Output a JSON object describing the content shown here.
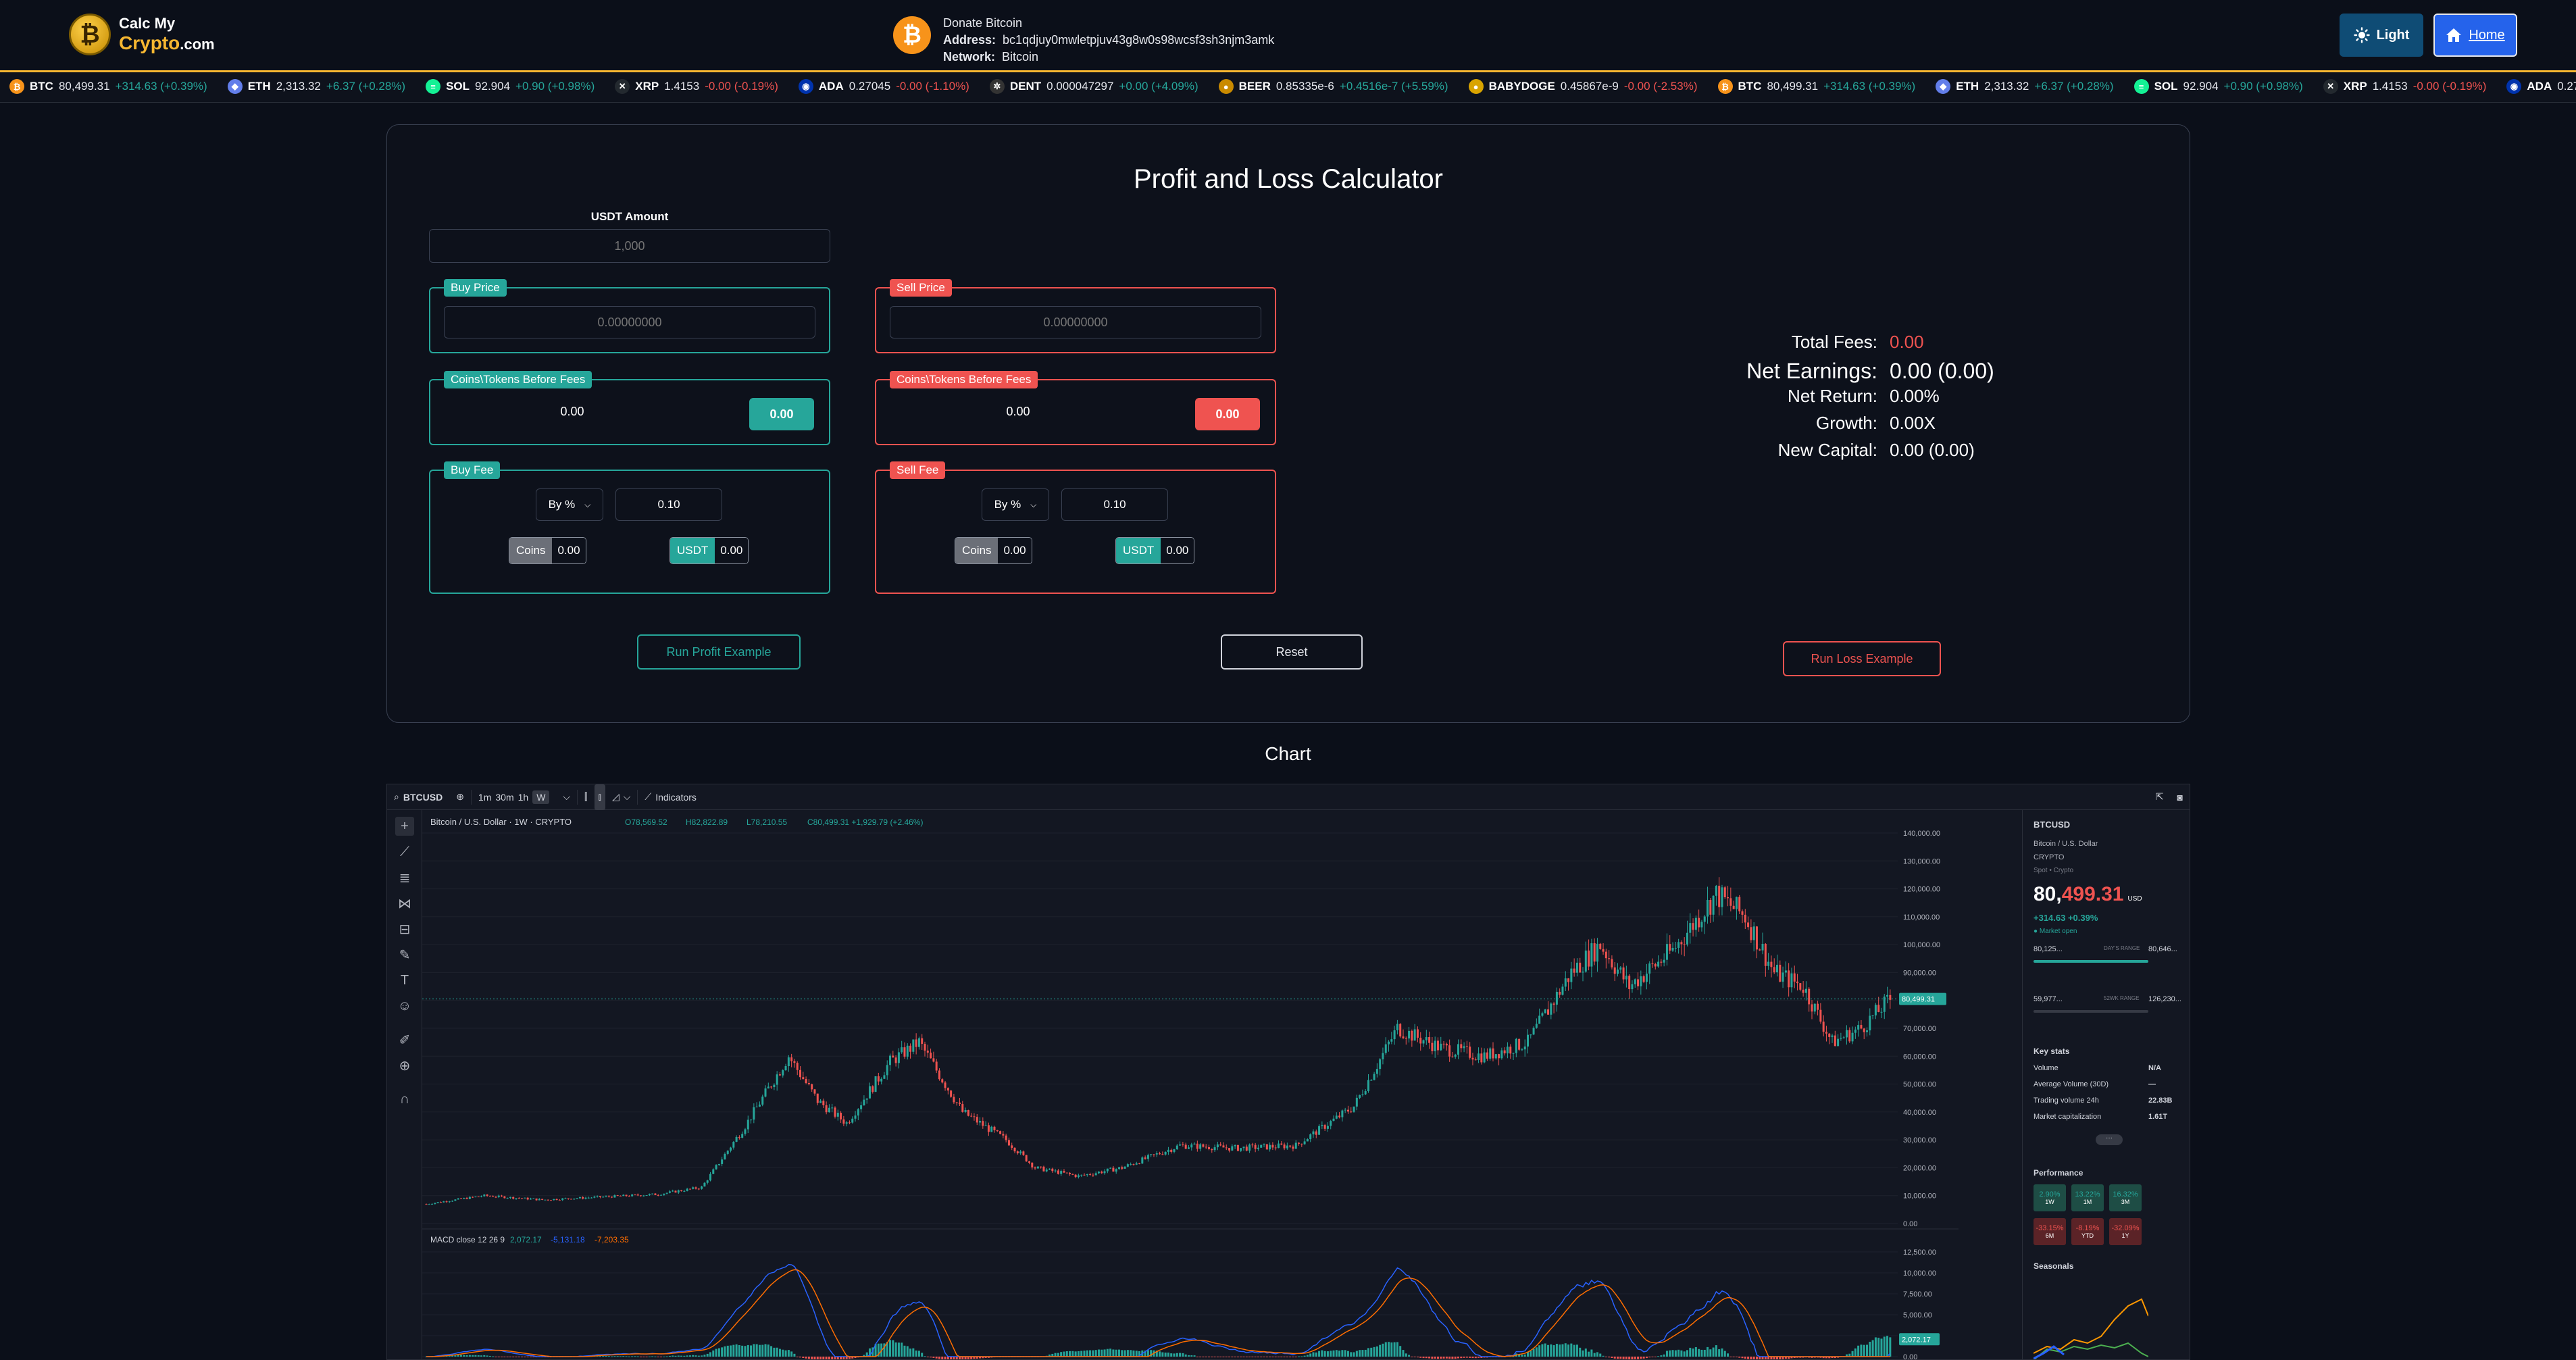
{
  "header": {
    "logo": {
      "top": "Calc My",
      "brand": "Crypto",
      "domain": ".com",
      "glyph": "₿"
    },
    "donate": {
      "title": "Donate Bitcoin",
      "address_label": "Address:",
      "address": "bc1qdjuy0mwletpjuv43g8w0s98wcsf3sh3njm3amk",
      "network_label": "Network:",
      "network": "Bitcoin",
      "glyph": "₿"
    },
    "theme_button": "Light",
    "home_button": "Home"
  },
  "ticker": [
    {
      "sym": "BTC",
      "price": "80,499.31",
      "change": "+314.63 (+0.39%)",
      "dir": "up",
      "color": "#f7931a",
      "glyph": "₿"
    },
    {
      "sym": "ETH",
      "price": "2,313.32",
      "change": "+6.37 (+0.28%)",
      "dir": "up",
      "color": "#627eea",
      "glyph": "◆"
    },
    {
      "sym": "SOL",
      "price": "92.904",
      "change": "+0.90 (+0.98%)",
      "dir": "up",
      "color": "#14f195",
      "glyph": "≡"
    },
    {
      "sym": "XRP",
      "price": "1.4153",
      "change": "-0.00 (-0.19%)",
      "dir": "dn",
      "color": "#23292f",
      "glyph": "✕"
    },
    {
      "sym": "ADA",
      "price": "0.27045",
      "change": "-0.00 (-1.10%)",
      "dir": "dn",
      "color": "#0033ad",
      "glyph": "◉"
    },
    {
      "sym": "DENT",
      "price": "0.000047297",
      "change": "+0.00 (+4.09%)",
      "dir": "up",
      "color": "#333",
      "glyph": "✲"
    },
    {
      "sym": "BEER",
      "price": "0.85335e-6",
      "change": "+0.4516e-7 (+5.59%)",
      "dir": "up",
      "color": "#c98a00",
      "glyph": "●"
    },
    {
      "sym": "BABYDOGE",
      "price": "0.45867e-9",
      "change": "-0.00 (-2.53%)",
      "dir": "dn",
      "color": "#d9a400",
      "glyph": "●"
    },
    {
      "sym": "BTC",
      "price": "80,499.31",
      "change": "+314.63 (+0.39%)",
      "dir": "up",
      "color": "#f7931a",
      "glyph": "₿"
    },
    {
      "sym": "ETH",
      "price": "2,313.32",
      "change": "+6.37 (+0.28%)",
      "dir": "up",
      "color": "#627eea",
      "glyph": "◆"
    },
    {
      "sym": "SOL",
      "price": "92.904",
      "change": "+0.90 (+0.98%)",
      "dir": "up",
      "color": "#14f195",
      "glyph": "≡"
    },
    {
      "sym": "XRP",
      "price": "1.4153",
      "change": "-0.00 (-0.19%)",
      "dir": "dn",
      "color": "#23292f",
      "glyph": "✕"
    },
    {
      "sym": "ADA",
      "price": "0.27",
      "change": "",
      "dir": "dn",
      "color": "#0033ad",
      "glyph": "◉"
    }
  ],
  "calculator": {
    "title": "Profit and Loss Calculator",
    "usdt_label": "USDT Amount",
    "usdt_placeholder": "1,000",
    "buy": {
      "price_label": "Buy Price",
      "price_placeholder": "0.00000000",
      "coins_label": "Coins\\Tokens Before Fees",
      "coins_value": "0.00",
      "coins_button": "0.00",
      "fee_label": "Buy Fee",
      "fee_mode": "By %",
      "fee_value": "0.10",
      "fee_coins_label": "Coins",
      "fee_coins_value": "0.00",
      "fee_usdt_label": "USDT",
      "fee_usdt_value": "0.00"
    },
    "sell": {
      "price_label": "Sell Price",
      "price_placeholder": "0.00000000",
      "coins_label": "Coins\\Tokens Before Fees",
      "coins_value": "0.00",
      "coins_button": "0.00",
      "fee_label": "Sell Fee",
      "fee_mode": "By %",
      "fee_value": "0.10",
      "fee_coins_label": "Coins",
      "fee_coins_value": "0.00",
      "fee_usdt_label": "USDT",
      "fee_usdt_value": "0.00"
    },
    "actions": {
      "profit": "Run Profit Example",
      "reset": "Reset",
      "loss": "Run Loss Example"
    },
    "results": {
      "total_fees_label": "Total Fees:",
      "total_fees": "0.00",
      "net_earnings_label": "Net Earnings:",
      "net_earnings": "0.00 (0.00)",
      "net_return_label": "Net Return:",
      "net_return": "0.00%",
      "growth_label": "Growth:",
      "growth": "0.00X",
      "new_capital_label": "New Capital:",
      "new_capital": "0.00 (0.00)"
    },
    "colors": {
      "green": "#26a69a",
      "red": "#ef5350",
      "grey": "#6b6f78"
    }
  },
  "chart_section": {
    "heading": "Chart",
    "toolbar": {
      "symbol": "BTCUSD",
      "intervals": [
        "1m",
        "30m",
        "1h",
        "W"
      ],
      "active_interval": "W",
      "indicators": "Indicators"
    },
    "legend": {
      "title": "Bitcoin / U.S. Dollar · 1W · CRYPTO",
      "o": "O78,569.52",
      "h": "H82,822.89",
      "l": "L78,210.55",
      "c": "C80,499.31 +1,929.79 (+2.46%)"
    },
    "price_tag": "80,499.31",
    "macd_legend": {
      "label": "MACD close 12 26 9",
      "v1": "2,072.17",
      "v2": "-5,131.18",
      "v3": "-7,203.35"
    },
    "macd_tag": "2,072.17",
    "side_panel": {
      "symbol": "BTCUSD",
      "name": "Bitcoin / U.S. Dollar",
      "exchange": "CRYPTO",
      "type": "Spot • Crypto",
      "price_main": "80,",
      "price_tail": "499.31",
      "currency": "USD",
      "change": "+314.63 +0.39%",
      "market": "● Market open",
      "days_low": "80,125...",
      "days_label": "DAY'S RANGE",
      "days_high": "80,646...",
      "wk_low": "59,977...",
      "wk_label": "52WK RANGE",
      "wk_high": "126,230...",
      "key_stats": "Key stats",
      "stats": [
        {
          "k": "Volume",
          "v": "N/A"
        },
        {
          "k": "Average Volume (30D)",
          "v": "—"
        },
        {
          "k": "Trading volume 24h",
          "v": "22.83B"
        },
        {
          "k": "Market capitalization",
          "v": "1.61T"
        }
      ],
      "more": "···",
      "performance": "Performance",
      "perf": [
        {
          "v": "2.90%",
          "p": "1W",
          "dir": "up"
        },
        {
          "v": "13.22%",
          "p": "1M",
          "dir": "up"
        },
        {
          "v": "16.32%",
          "p": "3M",
          "dir": "up"
        },
        {
          "v": "-33.15%",
          "p": "6M",
          "dir": "dn"
        },
        {
          "v": "-8.19%",
          "p": "YTD",
          "dir": "dn"
        },
        {
          "v": "-32.09%",
          "p": "1Y",
          "dir": "dn"
        }
      ],
      "seasonals": "Seasonals"
    }
  },
  "chart_data": {
    "type": "candlestick",
    "title": "Bitcoin / U.S. Dollar · 1W · CRYPTO",
    "ylim": [
      0,
      140000
    ],
    "yticks": [
      0,
      10000,
      20000,
      30000,
      40000,
      50000,
      60000,
      70000,
      80000,
      90000,
      100000,
      110000,
      120000,
      130000,
      140000
    ],
    "ytick_labels": [
      "0.00",
      "10,000.00",
      "20,000.00",
      "30,000.00",
      "40,000.00",
      "50,000.00",
      "60,000.00",
      "70,000.00",
      "80,000.00",
      "90,000.00",
      "100,000.00",
      "110,000.00",
      "120,000.00",
      "130,000.00",
      "140,000.00"
    ],
    "last_price": 80499.31,
    "trend_keypoints": [
      [
        0,
        7000
      ],
      [
        20,
        10000
      ],
      [
        40,
        8500
      ],
      [
        60,
        9500
      ],
      [
        80,
        10500
      ],
      [
        95,
        13000
      ],
      [
        110,
        35000
      ],
      [
        125,
        60000
      ],
      [
        135,
        44000
      ],
      [
        145,
        36000
      ],
      [
        160,
        58000
      ],
      [
        170,
        65000
      ],
      [
        185,
        40000
      ],
      [
        200,
        30000
      ],
      [
        210,
        20000
      ],
      [
        225,
        17000
      ],
      [
        240,
        20000
      ],
      [
        260,
        28000
      ],
      [
        280,
        27000
      ],
      [
        300,
        28000
      ],
      [
        320,
        42000
      ],
      [
        335,
        70000
      ],
      [
        350,
        63000
      ],
      [
        365,
        60000
      ],
      [
        380,
        65000
      ],
      [
        395,
        90000
      ],
      [
        405,
        100000
      ],
      [
        415,
        85000
      ],
      [
        430,
        98000
      ],
      [
        445,
        118000
      ],
      [
        455,
        110000
      ],
      [
        465,
        90000
      ],
      [
        475,
        85000
      ],
      [
        485,
        65000
      ],
      [
        495,
        70000
      ],
      [
        505,
        80499
      ]
    ],
    "macd": {
      "label": "MACD close 12 26 9",
      "ylim": [
        0,
        12500
      ],
      "yticks": [
        0,
        2500,
        5000,
        7500,
        10000,
        12500
      ],
      "ytick_labels": [
        "0.00",
        "2,500.00",
        "5,000.00",
        "7,500.00",
        "10,000.00",
        "12,500.00"
      ]
    }
  }
}
